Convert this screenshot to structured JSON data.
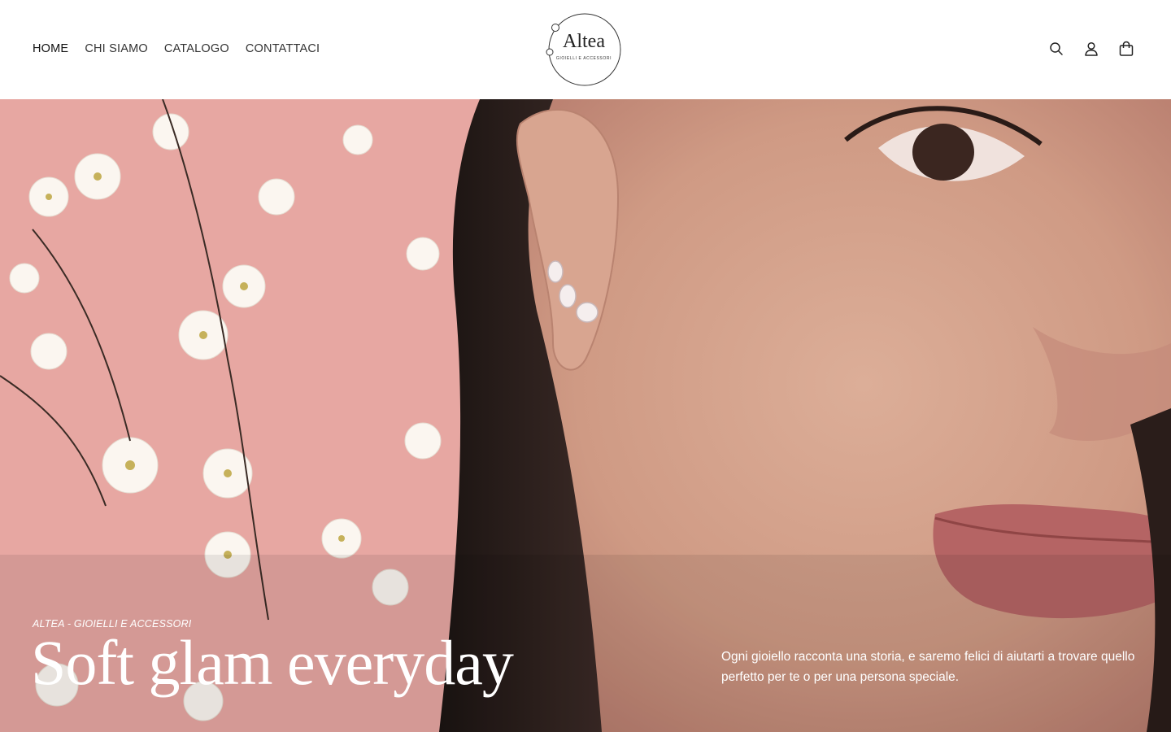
{
  "nav": {
    "items": [
      {
        "label": "HOME",
        "active": true
      },
      {
        "label": "CHI SIAMO",
        "active": false
      },
      {
        "label": "CATALOGO",
        "active": false
      },
      {
        "label": "CONTATTACI",
        "active": false
      }
    ]
  },
  "logo": {
    "name": "Altea",
    "tagline": "GIOIELLI E ACCESSORI"
  },
  "header_icons": [
    "search-icon",
    "account-icon",
    "cart-icon"
  ],
  "hero": {
    "eyebrow": "ALTEA - GIOIELLI E ACCESSORI",
    "title": "Soft glam everyday",
    "description": "Ogni gioiello racconta una storia, e saremo felici di aiutarti a trovare quello perfetto per te o per una persona speciale."
  },
  "colors": {
    "text_dark": "#111111",
    "hero_text": "#ffffff",
    "background_pink": "#e3a09c"
  }
}
